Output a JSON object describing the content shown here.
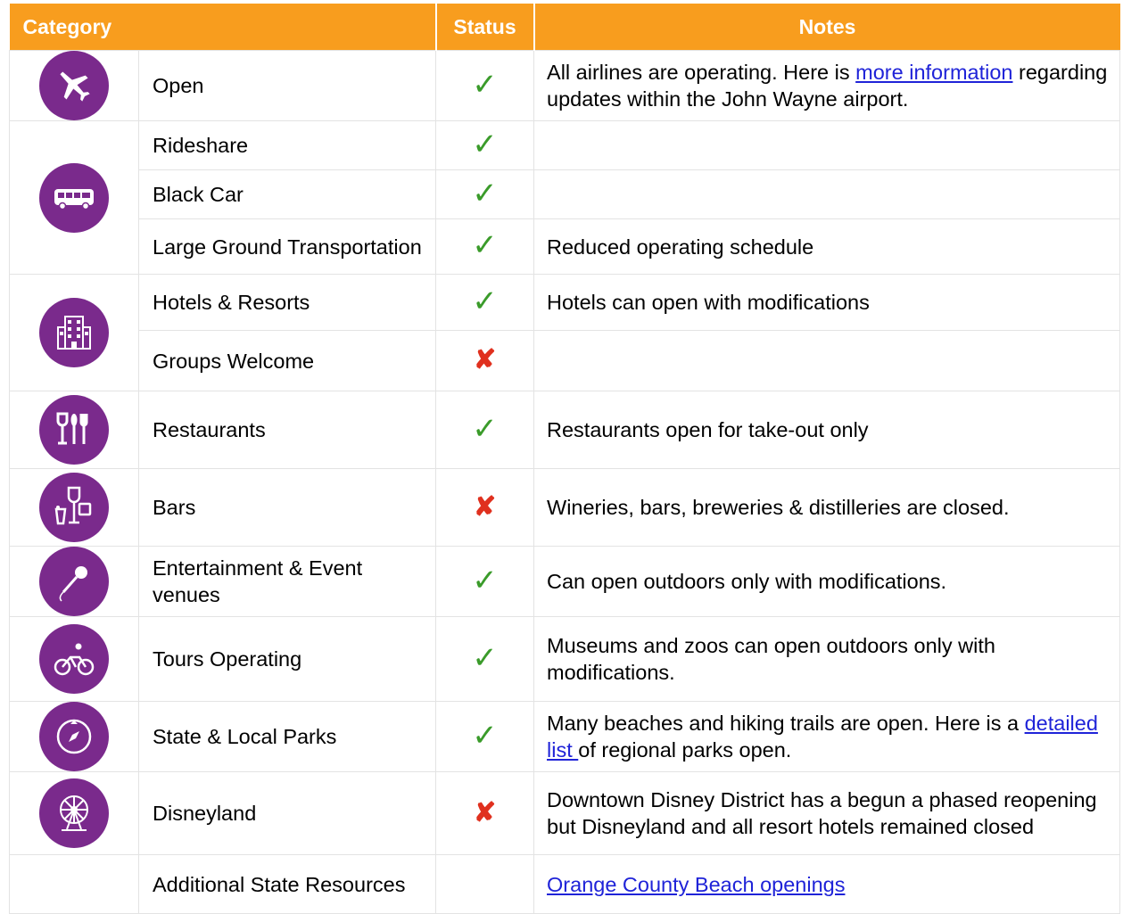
{
  "header": {
    "category": "Category",
    "status": "Status",
    "notes": "Notes"
  },
  "rows": [
    {
      "icon": "airplane-icon",
      "label": "Open",
      "status": "check",
      "notes_pre": "All airlines are operating. Here is ",
      "notes_link": "more information",
      "notes_post": " regarding updates within the John Wayne airport."
    },
    {
      "icon": "bus-icon",
      "label": "Rideshare",
      "status": "check"
    },
    {
      "label": "Black Car",
      "status": "check"
    },
    {
      "label": "Large Ground Transportation",
      "status": "check",
      "notes": "Reduced operating schedule"
    },
    {
      "icon": "hotel-building-icon",
      "label": "Hotels & Resorts",
      "status": "check",
      "notes": "Hotels can open with modifications"
    },
    {
      "label": "Groups Welcome",
      "status": "cross"
    },
    {
      "icon": "dining-icon",
      "label": "Restaurants",
      "status": "check",
      "notes": "Restaurants open for take-out only"
    },
    {
      "icon": "drinks-icon",
      "label": "Bars",
      "status": "cross",
      "notes": "Wineries, bars, breweries & distilleries are closed."
    },
    {
      "icon": "microphone-icon",
      "label": "Entertainment & Event venues",
      "status": "check",
      "notes": "Can open outdoors only with modifications."
    },
    {
      "icon": "cyclist-icon",
      "label": "Tours Operating",
      "status": "check",
      "notes": "Museums and zoos can open outdoors only with modifications."
    },
    {
      "icon": "compass-icon",
      "label": "State & Local Parks",
      "status": "check",
      "notes_pre": "Many beaches and hiking trails are open. Here is a ",
      "notes_link": "detailed list ",
      "notes_post": " of regional parks open."
    },
    {
      "icon": "ferris-wheel-icon",
      "label": "Disneyland",
      "status": "cross",
      "notes": "Downtown Disney District has a begun a phased reopening but Disneyland and all resort hotels remained closed"
    },
    {
      "label": "Additional State Resources",
      "notes_link": "Orange County Beach openings"
    }
  ],
  "symbols": {
    "check": "✓",
    "cross": "✘"
  },
  "colors": {
    "header_bg": "#f89d1e",
    "icon_circle": "#7a2a8c",
    "check": "#3a9b2a",
    "cross": "#e0301e",
    "link": "#1f23d8"
  }
}
